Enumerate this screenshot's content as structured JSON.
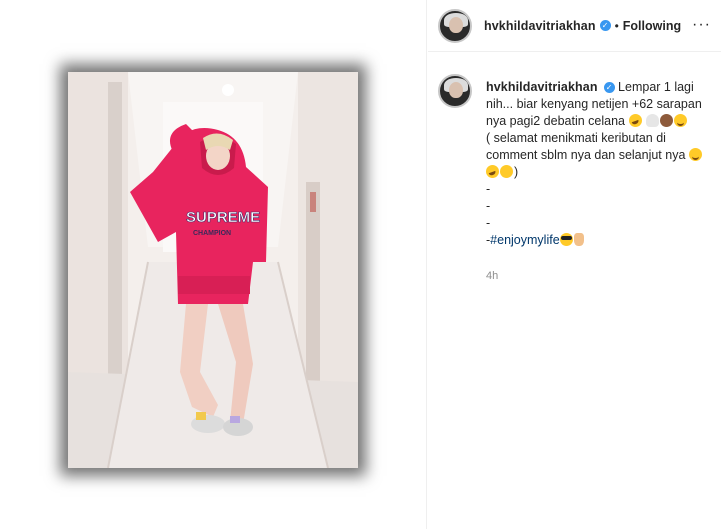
{
  "post": {
    "author": {
      "username": "hvkhildavitriakhan",
      "verified": true,
      "follow_status": "Following"
    },
    "caption": {
      "line1_text": "Lempar 1 lagi nih... biar kenyang netijen +62 sarapan nya pagi2 debatin celana",
      "line2_text": "( selamat menikmati keributan di comment sblm nya dan selanjut nya",
      "line2_close": ")",
      "dash1": "-",
      "dash2": "-",
      "dash3": "-",
      "hashtag_prefix": "-",
      "hashtag": "#enjoymylife"
    },
    "time_ago": "4h",
    "icons": {
      "more": "more-options-icon",
      "verified": "verified-badge-icon"
    },
    "colors": {
      "link": "#00376b",
      "verified": "#3897f0",
      "secondary_text": "#8e8e8e",
      "hoodie": "#e8245e"
    },
    "photo": {
      "hoodie_text": "SUPREME",
      "hoodie_subtext": "CHAMPION"
    }
  }
}
